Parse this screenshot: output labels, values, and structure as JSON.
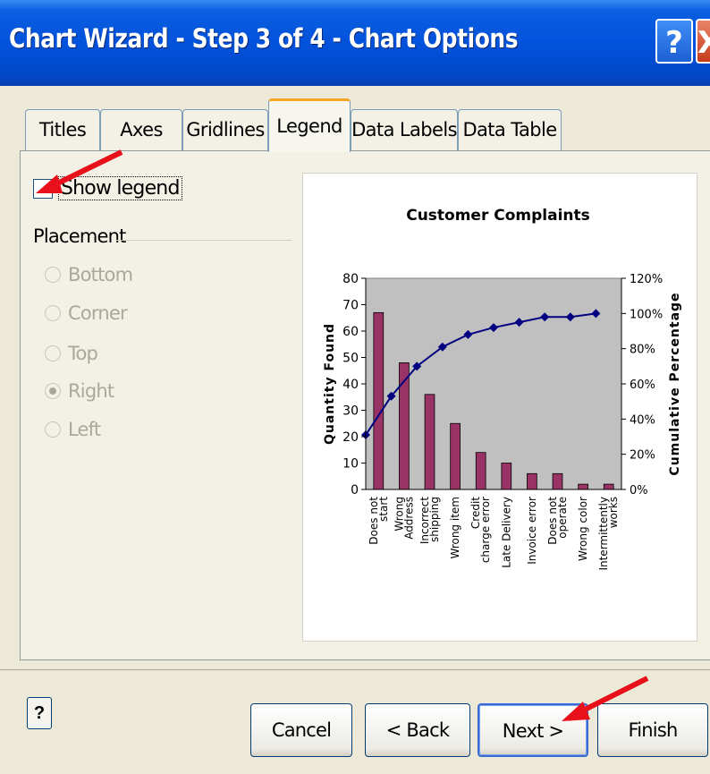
{
  "window": {
    "title": "Chart Wizard - Step 3 of 4 - Chart Options",
    "help_glyph": "?",
    "close_glyph": "X"
  },
  "tabs": [
    {
      "label": "Titles",
      "active": false
    },
    {
      "label": "Axes",
      "active": false
    },
    {
      "label": "Gridlines",
      "active": false
    },
    {
      "label": "Legend",
      "active": true
    },
    {
      "label": "Data Labels",
      "active": false
    },
    {
      "label": "Data Table",
      "active": false
    }
  ],
  "legend_options": {
    "show_legend": {
      "label": "Show legend",
      "checked": false
    },
    "placement_label": "Placement",
    "placements": [
      {
        "label": "Bottom",
        "selected": false
      },
      {
        "label": "Corner",
        "selected": false
      },
      {
        "label": "Top",
        "selected": false
      },
      {
        "label": "Right",
        "selected": true
      },
      {
        "label": "Left",
        "selected": false
      }
    ],
    "placement_enabled": false
  },
  "footer": {
    "help_glyph": "?",
    "cancel": "Cancel",
    "back": "< Back",
    "next": "Next >",
    "finish": "Finish"
  },
  "colors": {
    "bar": "#993366",
    "line": "#000080",
    "plot_area": "#c0c0c0",
    "arrow": "#e8101a"
  },
  "chart_data": {
    "type": "bar",
    "title": "Customer Complaints",
    "ylabel": "Quantity Found",
    "y2label": "Cumulative Percentage",
    "ylim": [
      0,
      80
    ],
    "y2lim": [
      0,
      120
    ],
    "yticks": [
      "0",
      "10",
      "20",
      "30",
      "40",
      "50",
      "60",
      "70",
      "80"
    ],
    "y2ticks": [
      "0%",
      "20%",
      "40%",
      "60%",
      "80%",
      "100%",
      "120%"
    ],
    "categories": [
      "Does not start",
      "Wrong Address",
      "Incorrect shipping",
      "Wrong item",
      "Credit charge error",
      "Late Delivery",
      "Invoice error",
      "Does not operate",
      "Wrong color",
      "Intermittently works"
    ],
    "category_lines": [
      [
        "Does not",
        "start"
      ],
      [
        "Wrong",
        "Address"
      ],
      [
        "Incorrect",
        "shipping"
      ],
      [
        "Wrong item"
      ],
      [
        "Credit",
        "charge error"
      ],
      [
        "Late Delivery"
      ],
      [
        "Invoice error"
      ],
      [
        "Does not",
        "operate"
      ],
      [
        "Wrong color"
      ],
      [
        "Intermittently",
        "works"
      ]
    ],
    "series": [
      {
        "type": "bar",
        "axis": "left",
        "values": [
          67,
          48,
          36,
          25,
          14,
          10,
          6,
          6,
          2,
          2
        ]
      },
      {
        "type": "line",
        "axis": "right",
        "values": [
          31,
          53,
          70,
          81,
          88,
          92,
          95,
          98,
          98,
          100
        ]
      }
    ],
    "grid": false,
    "legend": "none"
  }
}
